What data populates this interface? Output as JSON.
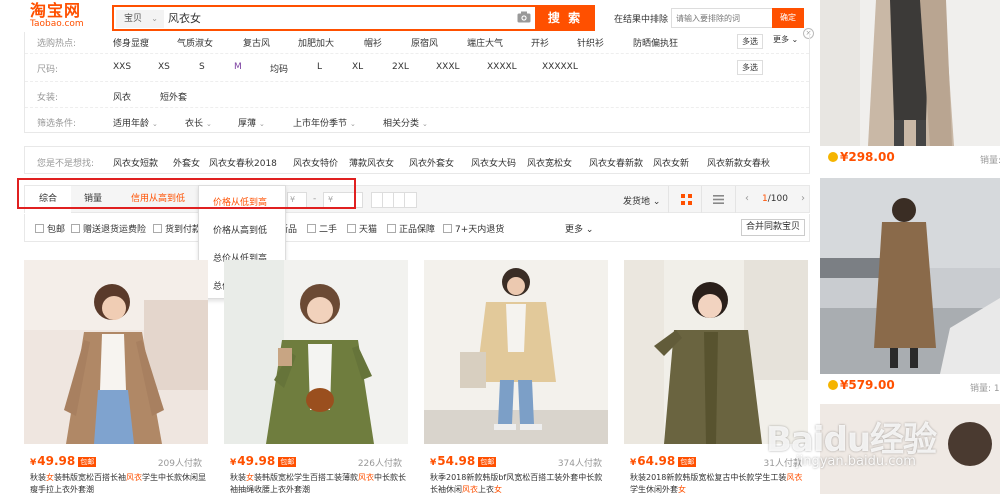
{
  "header": {
    "logo_cn": "淘宝网",
    "logo_en": "Taobao.com",
    "search_type": "宝贝",
    "search_query": "风衣女",
    "search_button": "搜 索",
    "within_label": "在结果中排除",
    "within_placeholder": "请输入要排除的词",
    "within_button": "确定"
  },
  "filters": {
    "hot_label": "选购热点:",
    "hot_items": [
      "修身显瘦",
      "气质淑女",
      "复古风",
      "加肥加大",
      "帽衫",
      "原宿风",
      "端庄大气",
      "开衫",
      "针织衫",
      "防晒偏执狂"
    ],
    "multi_label": "多选",
    "more_label": "更多",
    "size_label": "尺码:",
    "size_items": [
      "XXS",
      "XS",
      "S",
      "M",
      "均码",
      "L",
      "XL",
      "2XL",
      "XXXL",
      "XXXXL",
      "XXXXXL"
    ],
    "girl_label": "女装:",
    "girl_items": [
      "风衣",
      "短外套"
    ],
    "filter_label": "筛选条件:",
    "filter_items": [
      "适用年龄",
      "衣长",
      "厚薄",
      "上市年份季节",
      "相关分类"
    ]
  },
  "suggest": {
    "label": "您是不是想找:",
    "items": [
      "风衣女短款",
      "外套女",
      "风衣女春秋2018",
      "风衣女特价",
      "薄款风衣女",
      "风衣外套女",
      "风衣女大码",
      "风衣宽松女",
      "风衣女春新款",
      "风衣女新",
      "风衣新款女春秋"
    ]
  },
  "sortbar": {
    "tabs": [
      "综合",
      "销量",
      "信用从高到低",
      "价格从低到高"
    ],
    "price_from": "¥",
    "price_to": "¥",
    "ship_from": "发货地",
    "page_current": "1",
    "page_total": "/100"
  },
  "dropdown": {
    "items": [
      "价格从低到高",
      "价格从高到低",
      "总价从低到高",
      "总价从高到低"
    ]
  },
  "options": {
    "items": [
      "包邮",
      "赠送退货运费险",
      "货到付款",
      "新品",
      "二手",
      "天猫",
      "正品保障",
      "7+天内退货"
    ],
    "more": "更多",
    "merge": "合并同款宝贝"
  },
  "products": [
    {
      "price": "49.98",
      "postfree": "包邮",
      "buyers": "209人付款",
      "title_pre": "秋装",
      "title_hl1": "女",
      "title_mid": "装韩版宽松百搭长袖",
      "title_hl2": "风衣",
      "title_post": "学生中长款休闲显瘦手拉上衣外套潮"
    },
    {
      "price": "49.98",
      "postfree": "包邮",
      "buyers": "226人付款",
      "title_pre": "秋装",
      "title_hl1": "女",
      "title_mid": "装韩版宽松学生百搭工装薄款",
      "title_hl2": "风衣",
      "title_post": "中长款长袖抽绳收腰上衣外套潮"
    },
    {
      "price": "54.98",
      "postfree": "包邮",
      "buyers": "374人付款",
      "title_pre": "秋季2018新款韩版bf风宽松百搭工装外套中长款长袖休闲",
      "title_hl1": "风衣",
      "title_mid": "上衣",
      "title_hl2": "女",
      "title_post": ""
    },
    {
      "price": "64.98",
      "postfree": "包邮",
      "buyers": "31人付款",
      "title_pre": "秋装2018新款韩版宽松复古中长款学生工装",
      "title_hl1": "风衣",
      "title_mid": "学生休闲外套",
      "title_hl2": "女",
      "title_post": ""
    }
  ],
  "right_items": [
    {
      "price": "298.00",
      "sales": "销量:"
    },
    {
      "price": "579.00",
      "sales": "销量: 1"
    }
  ],
  "watermark": {
    "text": "Baidu经验",
    "url": "jingyan.baidu.com"
  },
  "colors": {
    "accent": "#ff5000",
    "highlight_box": "#e02020"
  }
}
